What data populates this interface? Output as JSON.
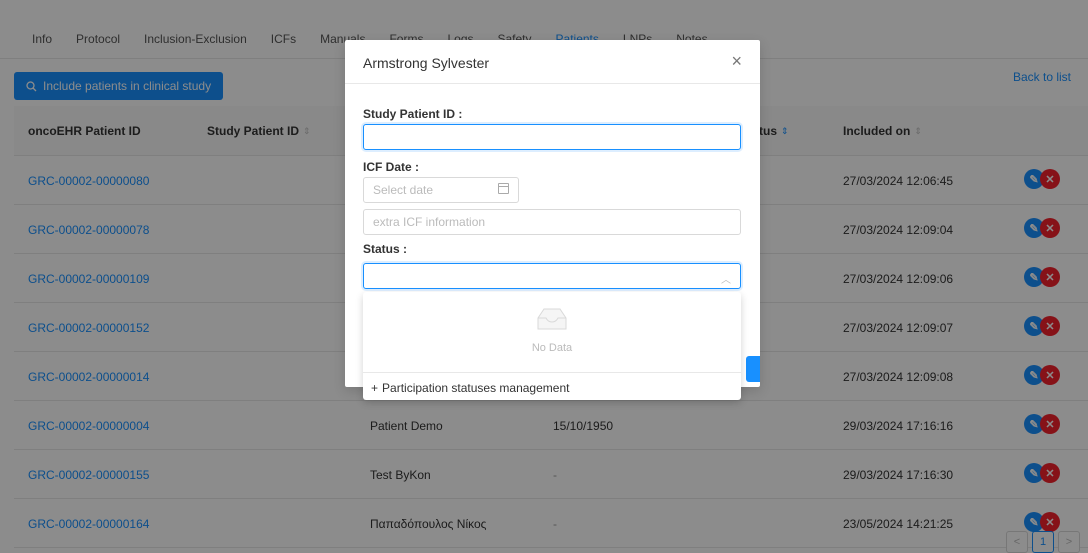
{
  "tabs": [
    {
      "label": "Info"
    },
    {
      "label": "Protocol"
    },
    {
      "label": "Inclusion-Exclusion"
    },
    {
      "label": "ICFs"
    },
    {
      "label": "Manuals"
    },
    {
      "label": "Forms"
    },
    {
      "label": "Logs"
    },
    {
      "label": "Safety"
    },
    {
      "label": "Patients",
      "active": true
    },
    {
      "label": "LNPs"
    },
    {
      "label": "Notes"
    }
  ],
  "toolbar": {
    "include_label": "Include patients in clinical study",
    "back_label": "Back to list"
  },
  "table": {
    "headers": {
      "oncoehr_id": "oncoEHR Patient ID",
      "study_id": "Study Patient ID",
      "status": "tus",
      "included_on": "Included on"
    },
    "rows": [
      {
        "oncoehr_id": "GRC-00002-00000080",
        "name": "",
        "dob": "",
        "included_on": "27/03/2024 12:06:45"
      },
      {
        "oncoehr_id": "GRC-00002-00000078",
        "name": "",
        "dob": "",
        "included_on": "27/03/2024 12:09:04"
      },
      {
        "oncoehr_id": "GRC-00002-00000109",
        "name": "",
        "dob": "",
        "included_on": "27/03/2024 12:09:06"
      },
      {
        "oncoehr_id": "GRC-00002-00000152",
        "name": "",
        "dob": "",
        "included_on": "27/03/2024 12:09:07"
      },
      {
        "oncoehr_id": "GRC-00002-00000014",
        "name": "",
        "dob": "",
        "included_on": "27/03/2024 12:09:08"
      },
      {
        "oncoehr_id": "GRC-00002-00000004",
        "name": "Patient Demo",
        "dob": "15/10/1950",
        "included_on": "29/03/2024 17:16:16"
      },
      {
        "oncoehr_id": "GRC-00002-00000155",
        "name": "Test ByKon",
        "dob": "-",
        "included_on": "29/03/2024 17:16:30"
      },
      {
        "oncoehr_id": "GRC-00002-00000164",
        "name": "Παπαδόπουλος Νίκος",
        "dob": "-",
        "included_on": "23/05/2024 14:21:25"
      }
    ]
  },
  "pagination": {
    "prev": "<",
    "current": "1",
    "next": ">"
  },
  "modal": {
    "title": "Armstrong Sylvester",
    "close": "×",
    "study_id_label": "Study Patient ID :",
    "study_id_value": "",
    "icf_date_label": "ICF Date :",
    "date_placeholder": "Select date",
    "extra_placeholder": "extra ICF information",
    "status_label": "Status :",
    "status_value": ""
  },
  "dropdown": {
    "empty_text": "No Data",
    "manage_label": "Participation statuses management"
  },
  "colors": {
    "accent": "#1890ff",
    "danger": "#f5222d"
  }
}
